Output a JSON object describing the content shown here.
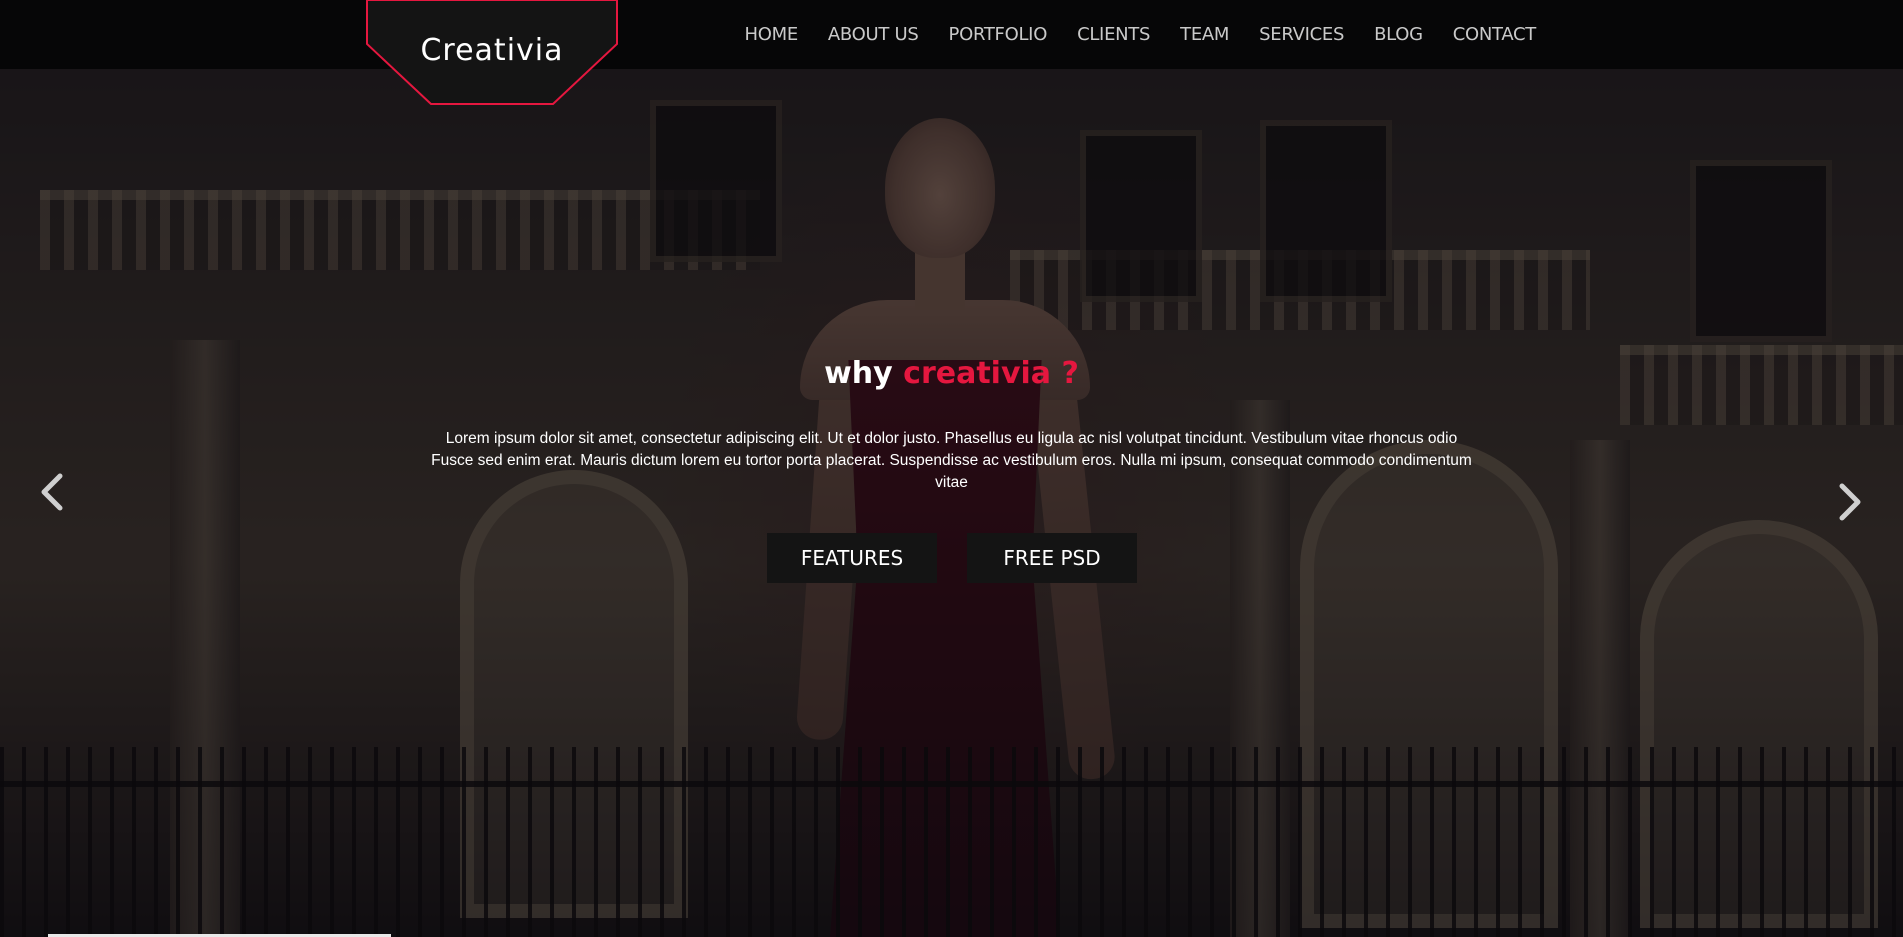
{
  "header": {
    "logo": "Creativia",
    "nav": [
      {
        "label": "HOME"
      },
      {
        "label": "ABOUT US"
      },
      {
        "label": "PORTFOLIO"
      },
      {
        "label": "CLIENTS"
      },
      {
        "label": "TEAM"
      },
      {
        "label": "SERVICES"
      },
      {
        "label": "BLOG"
      },
      {
        "label": "CONTACT"
      }
    ]
  },
  "hero": {
    "title_prefix": "why",
    "title_accent": "creativia ?",
    "description": "Lorem ipsum dolor sit amet, consectetur adipiscing elit. Ut et dolor justo. Phasellus eu ligula ac nisl volutpat tincidunt. Vestibulum vitae rhoncus odio Fusce sed enim erat. Mauris dictum lorem eu tortor porta placerat. Suspendisse ac vestibulum eros. Nulla mi ipsum, consequat commodo condimentum vitae",
    "buttons": {
      "features": "FEATURES",
      "free_psd": "FREE PSD"
    },
    "prev_icon": "chevron-left-icon",
    "next_icon": "chevron-right-icon"
  },
  "colors": {
    "accent": "#e5173f",
    "topbar": "#050506",
    "button_bg": "#141414",
    "text": "#ffffff",
    "nav_text": "#c9c9c9"
  }
}
